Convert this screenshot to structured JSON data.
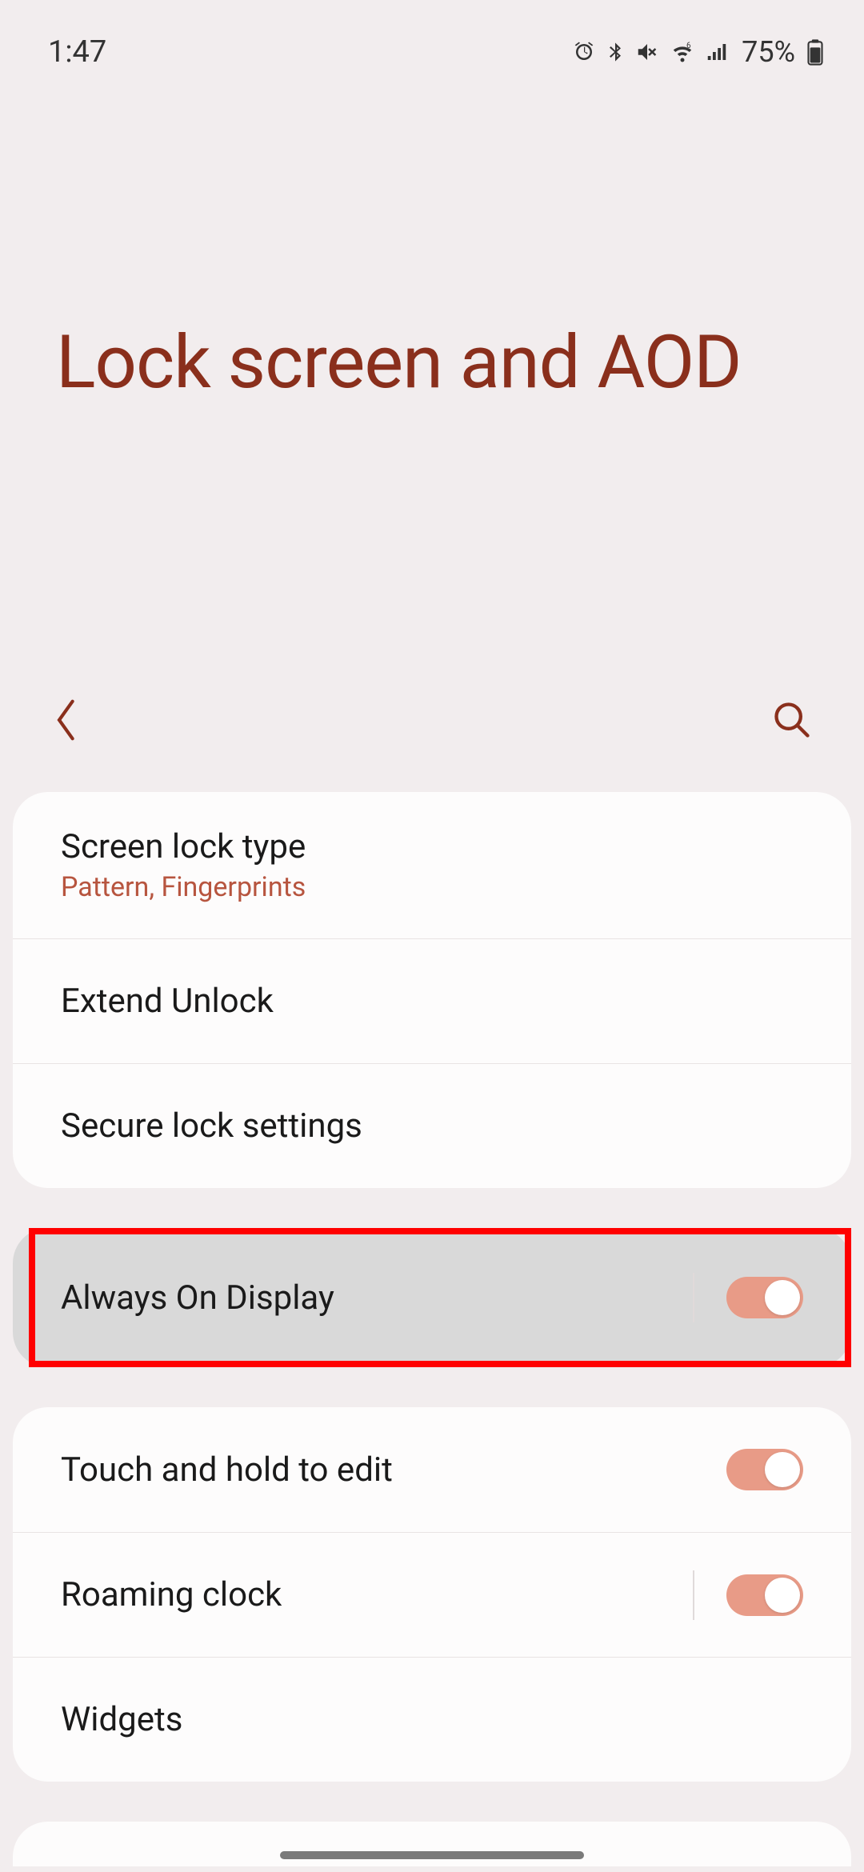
{
  "status": {
    "time": "1:47",
    "battery_pct": "75%",
    "icons": [
      "alarm",
      "bluetooth",
      "mute-vibrate",
      "wifi6",
      "signal",
      "battery"
    ]
  },
  "header": {
    "title": "Lock screen and AOD"
  },
  "colors": {
    "accent": "#8a2f1c",
    "toggle_on": "#e89b87",
    "highlight_border": "#ff0000"
  },
  "groups": [
    {
      "rows": [
        {
          "key": "screen_lock_type",
          "title": "Screen lock type",
          "subtitle": "Pattern, Fingerprints",
          "toggle": null
        },
        {
          "key": "extend_unlock",
          "title": "Extend Unlock",
          "subtitle": null,
          "toggle": null
        },
        {
          "key": "secure_lock_settings",
          "title": "Secure lock settings",
          "subtitle": null,
          "toggle": null
        }
      ]
    },
    {
      "highlighted": true,
      "rows": [
        {
          "key": "always_on_display",
          "title": "Always On Display",
          "subtitle": null,
          "toggle": true
        }
      ]
    },
    {
      "rows": [
        {
          "key": "touch_hold_edit",
          "title": "Touch and hold to edit",
          "subtitle": null,
          "toggle": true
        },
        {
          "key": "roaming_clock",
          "title": "Roaming clock",
          "subtitle": null,
          "toggle": true
        },
        {
          "key": "widgets",
          "title": "Widgets",
          "subtitle": null,
          "toggle": null
        }
      ]
    }
  ]
}
